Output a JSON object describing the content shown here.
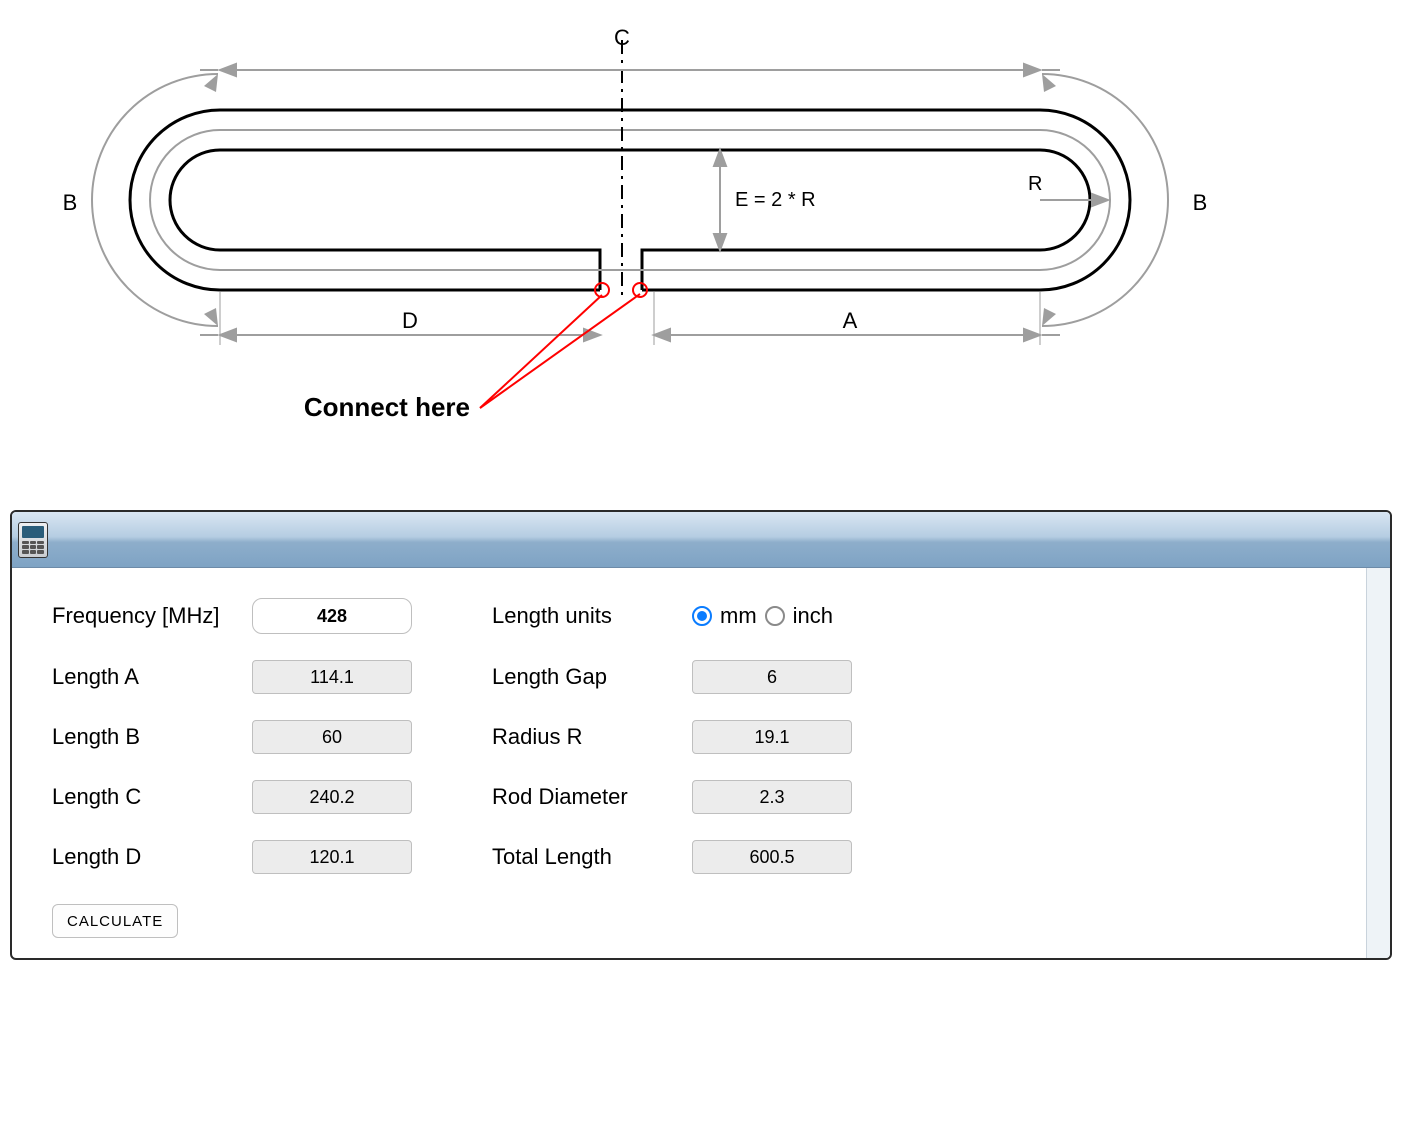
{
  "diagram": {
    "label_C": "C",
    "label_B_left": "B",
    "label_B_right": "B",
    "label_D": "D",
    "label_A": "A",
    "label_R": "R",
    "label_E": "E = 2 * R",
    "connect_label": "Connect here"
  },
  "panel": {
    "icon": "calculator-icon",
    "fields": {
      "frequency_label": "Frequency [MHz]",
      "frequency_value": "428",
      "length_a_label": "Length A",
      "length_a_value": "114.1",
      "length_b_label": "Length B",
      "length_b_value": "60",
      "length_c_label": "Length C",
      "length_c_value": "240.2",
      "length_d_label": "Length D",
      "length_d_value": "120.1",
      "units_label": "Length units",
      "units_opt1": "mm",
      "units_opt2": "inch",
      "units_selected": "mm",
      "gap_label": "Length Gap",
      "gap_value": "6",
      "radius_label": "Radius R",
      "radius_value": "19.1",
      "rod_label": "Rod Diameter",
      "rod_value": "2.3",
      "total_label": "Total Length",
      "total_value": "600.5"
    },
    "calculate_label": "CALCULATE"
  }
}
